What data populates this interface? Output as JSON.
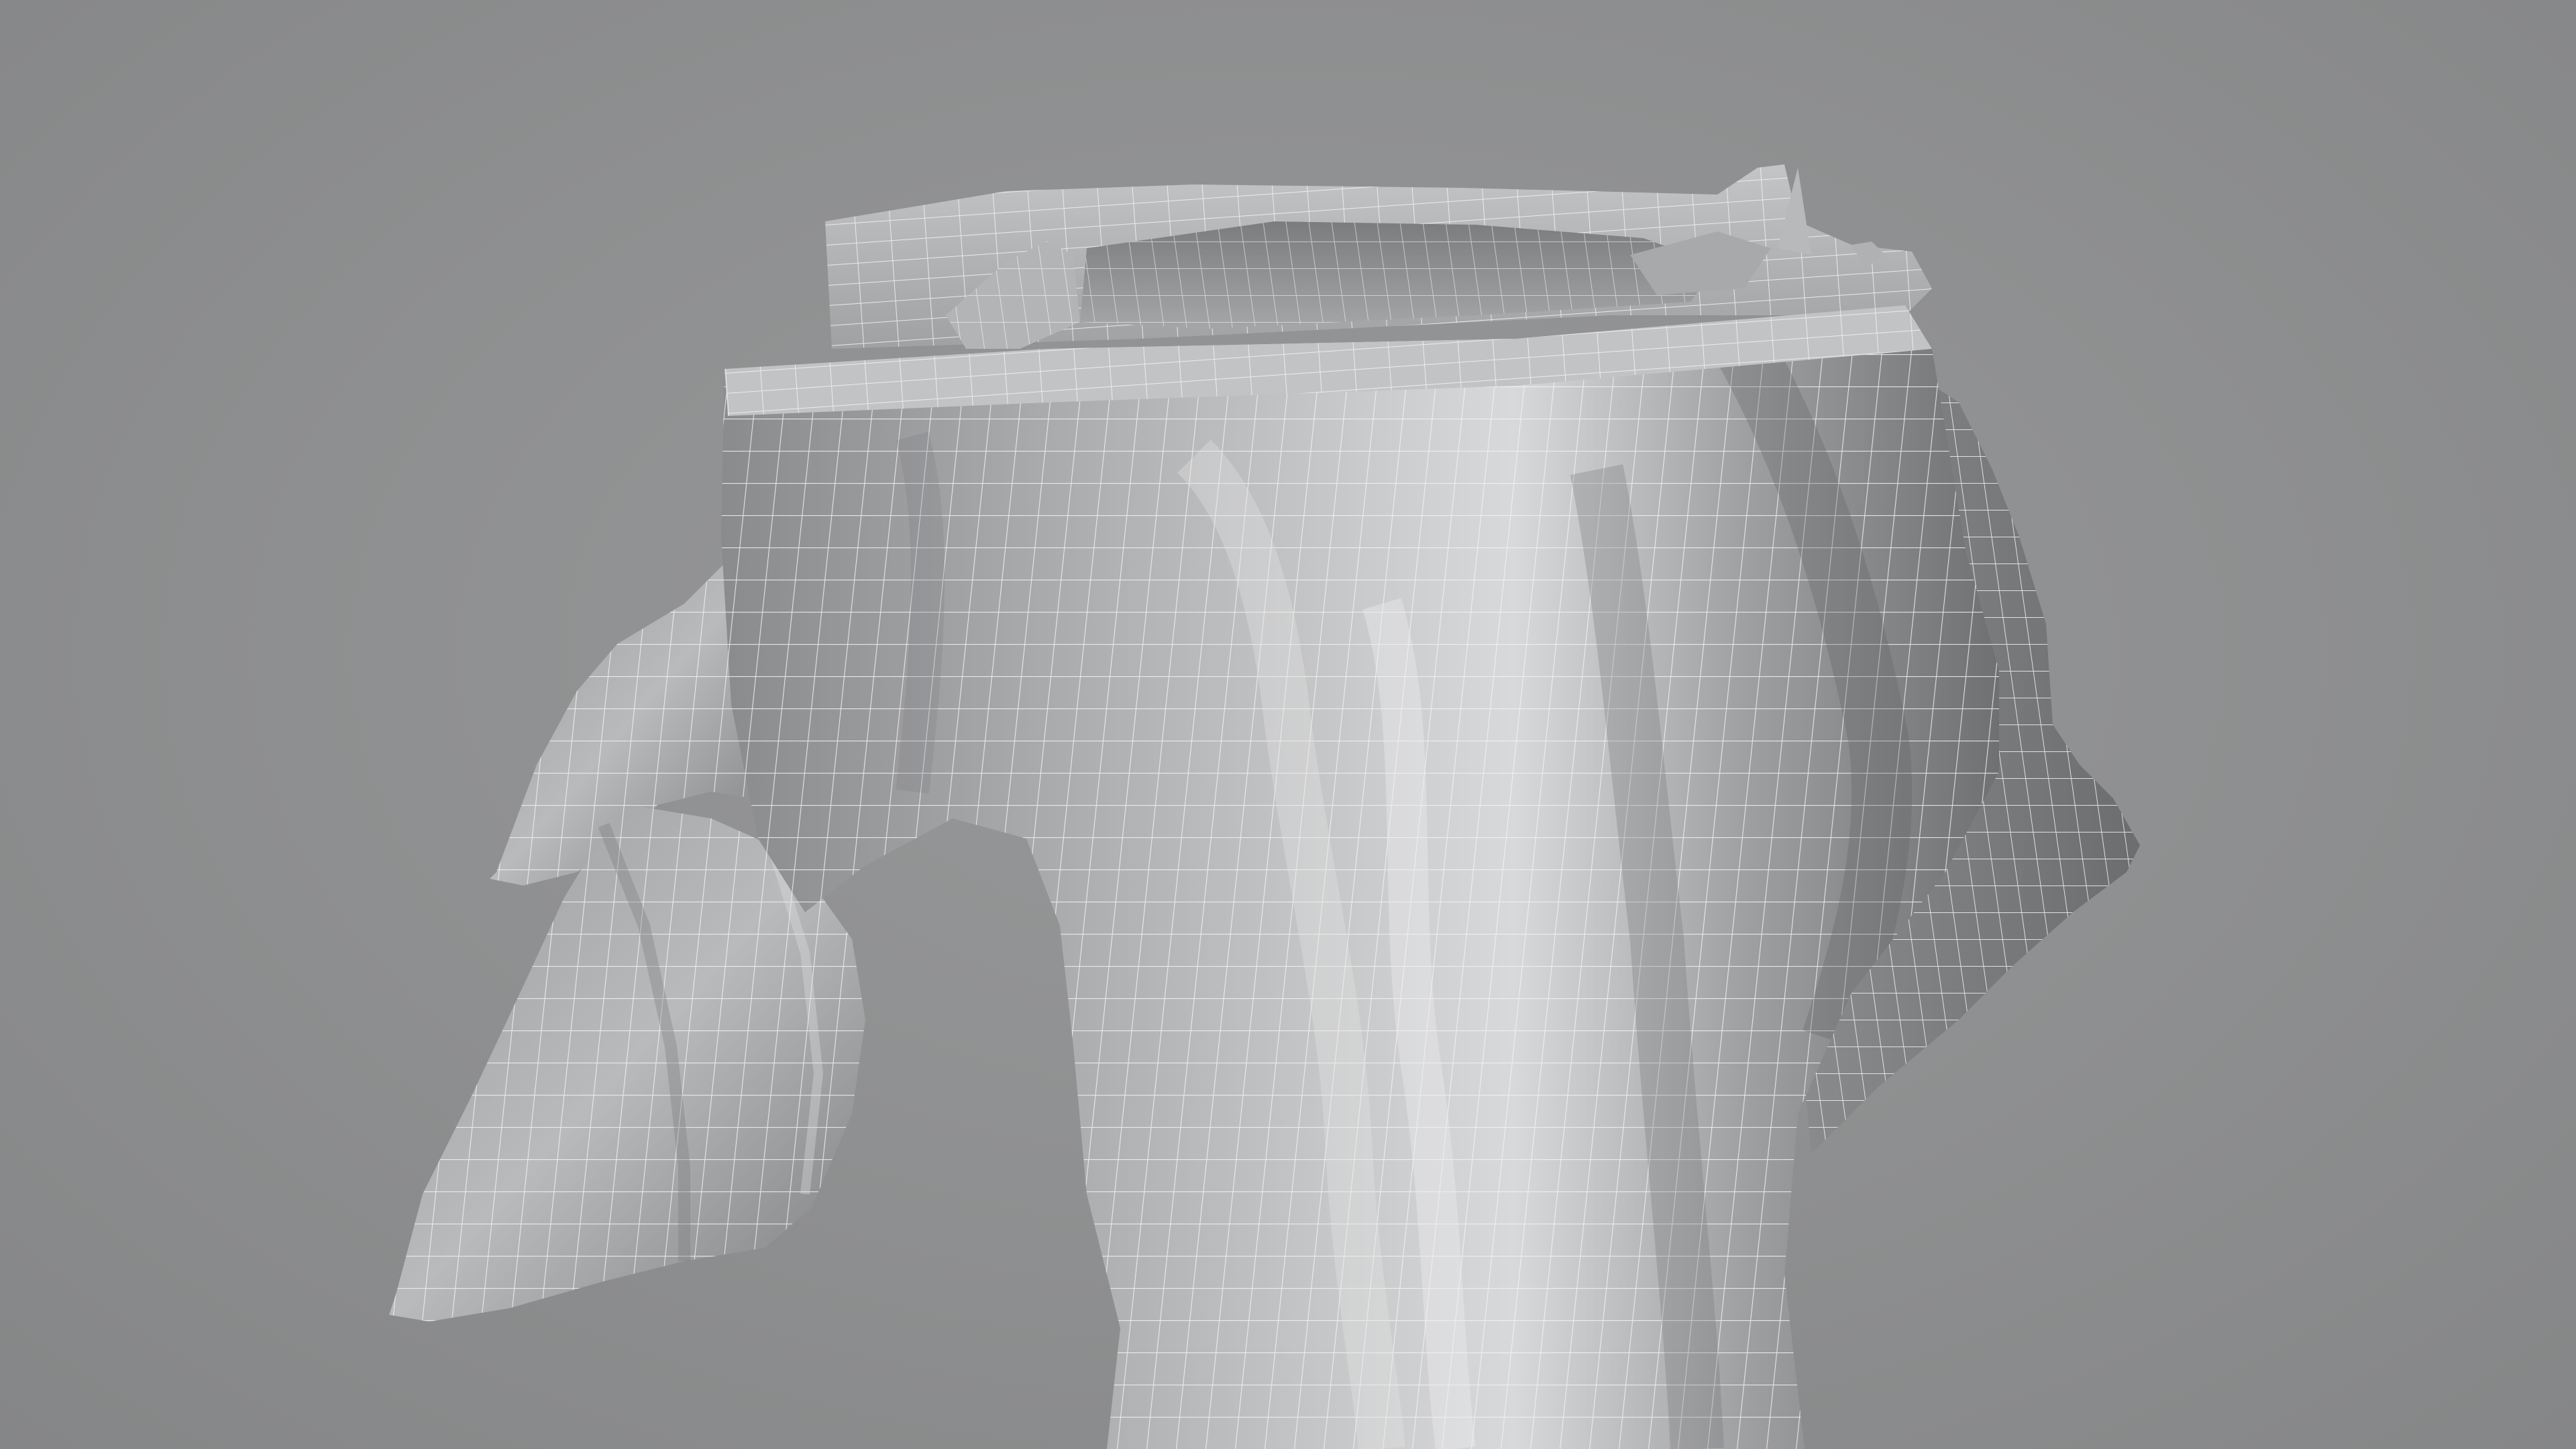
{
  "viewport": {
    "background_color": "#8f9091",
    "mesh_base_color": "#c8c9ca",
    "mesh_shadow_color": "#6d6e70",
    "wire_color": "#f2f2f2",
    "shading_mode": "solid-with-wireframe-overlay",
    "subject": "tree-stump-mesh-icon"
  }
}
